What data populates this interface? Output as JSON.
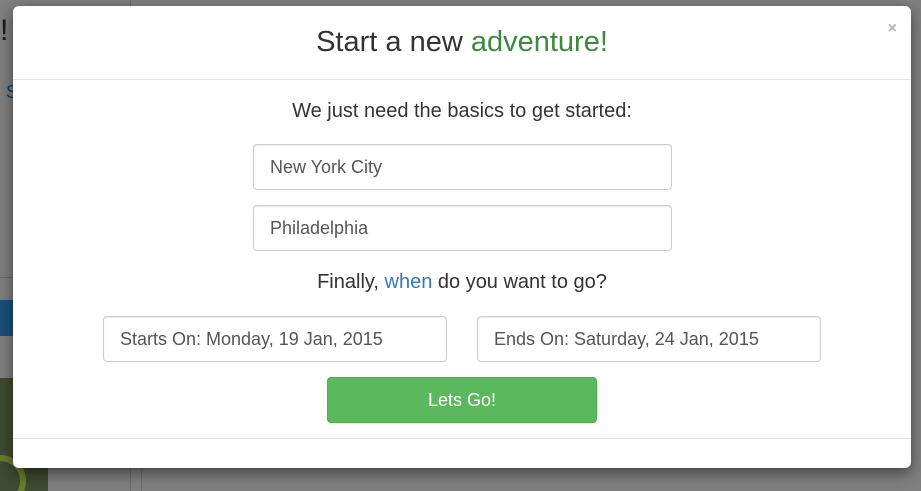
{
  "background": {
    "partial_heading": "!",
    "partial_link": "S"
  },
  "modal": {
    "title_prefix": "Start a new ",
    "title_accent": "adventure!",
    "close_label": "×",
    "subtitle": "We just need the basics to get started:",
    "from_value": "New York City",
    "to_value": "Philadelphia",
    "when_prefix": "Finally, ",
    "when_accent": "when",
    "when_suffix": " do you want to go?",
    "start_value": "Starts On: Monday, 19 Jan, 2015",
    "end_value": "Ends On: Saturday, 24 Jan, 2015",
    "submit_label": "Lets Go!"
  },
  "colors": {
    "accent_green": "#3c8a3c",
    "accent_blue": "#337ab7",
    "button_green": "#5cb85c",
    "overlay": "#808080"
  }
}
